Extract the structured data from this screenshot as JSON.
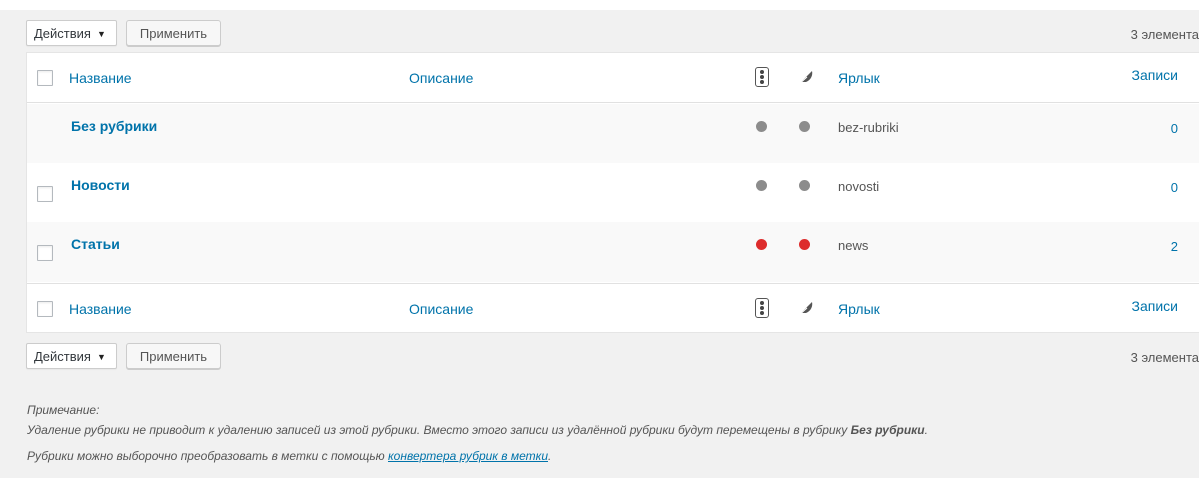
{
  "bulk_actions": {
    "select_label": "Действия",
    "apply_label": "Применить"
  },
  "item_count": "3 элемента",
  "columns": {
    "name": "Название",
    "description": "Описание",
    "slug": "Ярлык",
    "posts": "Записи"
  },
  "column_icons": [
    "traffic-light-icon",
    "feather-icon"
  ],
  "rows": [
    {
      "name": "Без рубрики",
      "slug": "bez-rubriki",
      "posts": "0",
      "color1": "#8c8c8c",
      "color2": "#8c8c8c",
      "has_checkbox": false
    },
    {
      "name": "Новости",
      "slug": "novosti",
      "posts": "0",
      "color1": "#8c8c8c",
      "color2": "#8c8c8c",
      "has_checkbox": true
    },
    {
      "name": "Статьи",
      "slug": "news",
      "posts": "2",
      "color1": "#dd2c2c",
      "color2": "#dd2c2c",
      "has_checkbox": true
    }
  ],
  "note": {
    "heading": "Примечание:",
    "line1_text": "Удаление рубрики не приводит к удалению записей из этой рубрики. Вместо этого записи из удалённой рубрики будут перемещены в рубрику ",
    "line1_bold": "Без рубрики",
    "line1_end": ".",
    "line2_text": "Рубрики можно выборочно преобразовать в метки с помощью ",
    "line2_link": "конвертера рубрик в метки",
    "line2_end": "."
  }
}
